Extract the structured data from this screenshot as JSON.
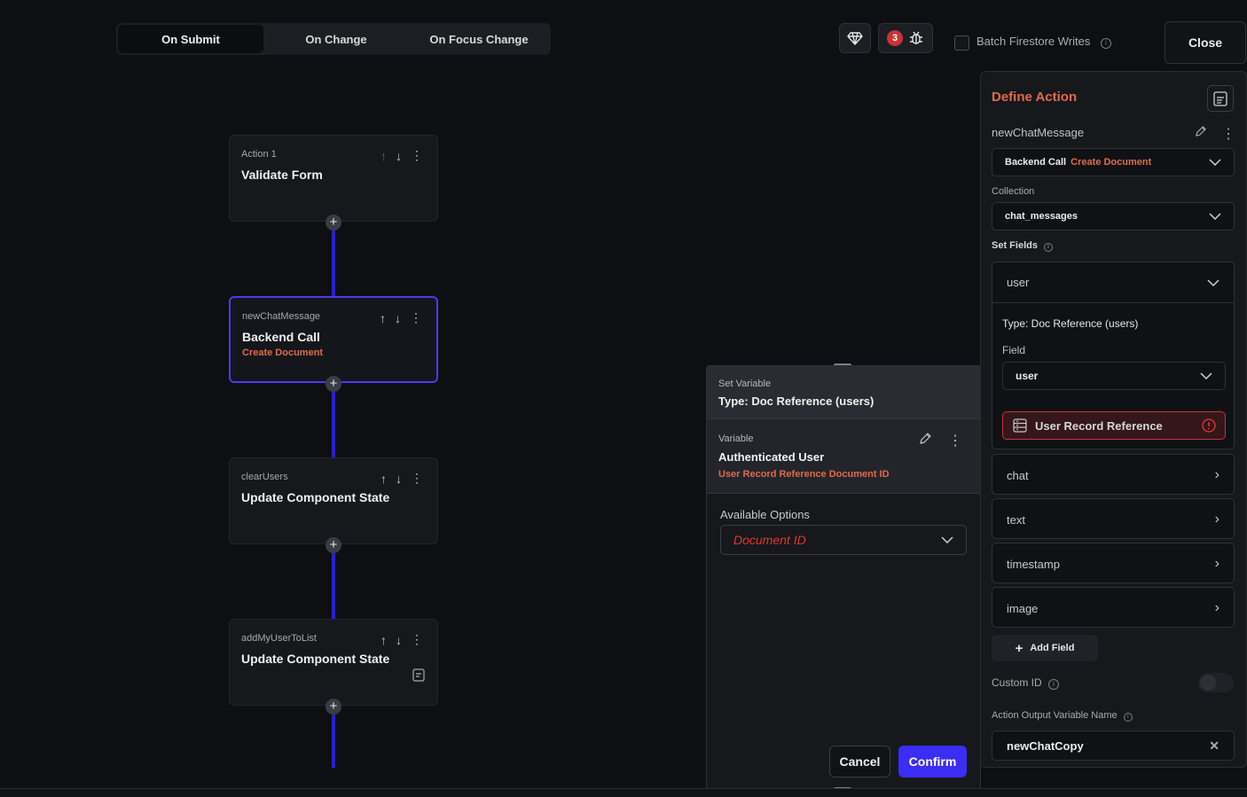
{
  "tabs": [
    "On Submit",
    "On Change",
    "On Focus Change"
  ],
  "toolbar": {
    "error_count": "3",
    "batch_label": "Batch Firestore Writes",
    "close_label": "Close"
  },
  "actions": [
    {
      "kicker": "Action 1",
      "title": "Validate Form",
      "sub": ""
    },
    {
      "kicker": "newChatMessage",
      "title": "Backend Call",
      "sub": "Create Document"
    },
    {
      "kicker": "clearUsers",
      "title": "Update Component State",
      "sub": ""
    },
    {
      "kicker": "addMyUserToList",
      "title": "Update Component State",
      "sub": ""
    }
  ],
  "modal": {
    "kicker": "Set Variable",
    "title": "Type: Doc Reference (users)",
    "variable_kicker": "Variable",
    "variable_title": "Authenticated User",
    "variable_sub": "User Record Reference Document ID",
    "available_label": "Available Options",
    "option_value": "Document ID",
    "cancel": "Cancel",
    "confirm": "Confirm"
  },
  "panel": {
    "title": "Define Action",
    "action_name": "newChatMessage",
    "action_type": "Backend Call",
    "action_subtype": "Create Document",
    "collection_label": "Collection",
    "collection_value": "chat_messages",
    "set_fields_label": "Set Fields",
    "field_user": "user",
    "type_label": "Type: Doc Reference (users)",
    "field_label": "Field",
    "field_value": "user",
    "reference_label": "User Record Reference",
    "other_fields": [
      "chat",
      "text",
      "timestamp",
      "image"
    ],
    "add_field": "Add Field",
    "custom_id_label": "Custom ID",
    "output_label": "Action Output Variable Name",
    "output_value": "newChatCopy"
  },
  "colors": {
    "accent": "#3b2df3",
    "orange": "#e06b4b",
    "error": "#c2343c"
  }
}
